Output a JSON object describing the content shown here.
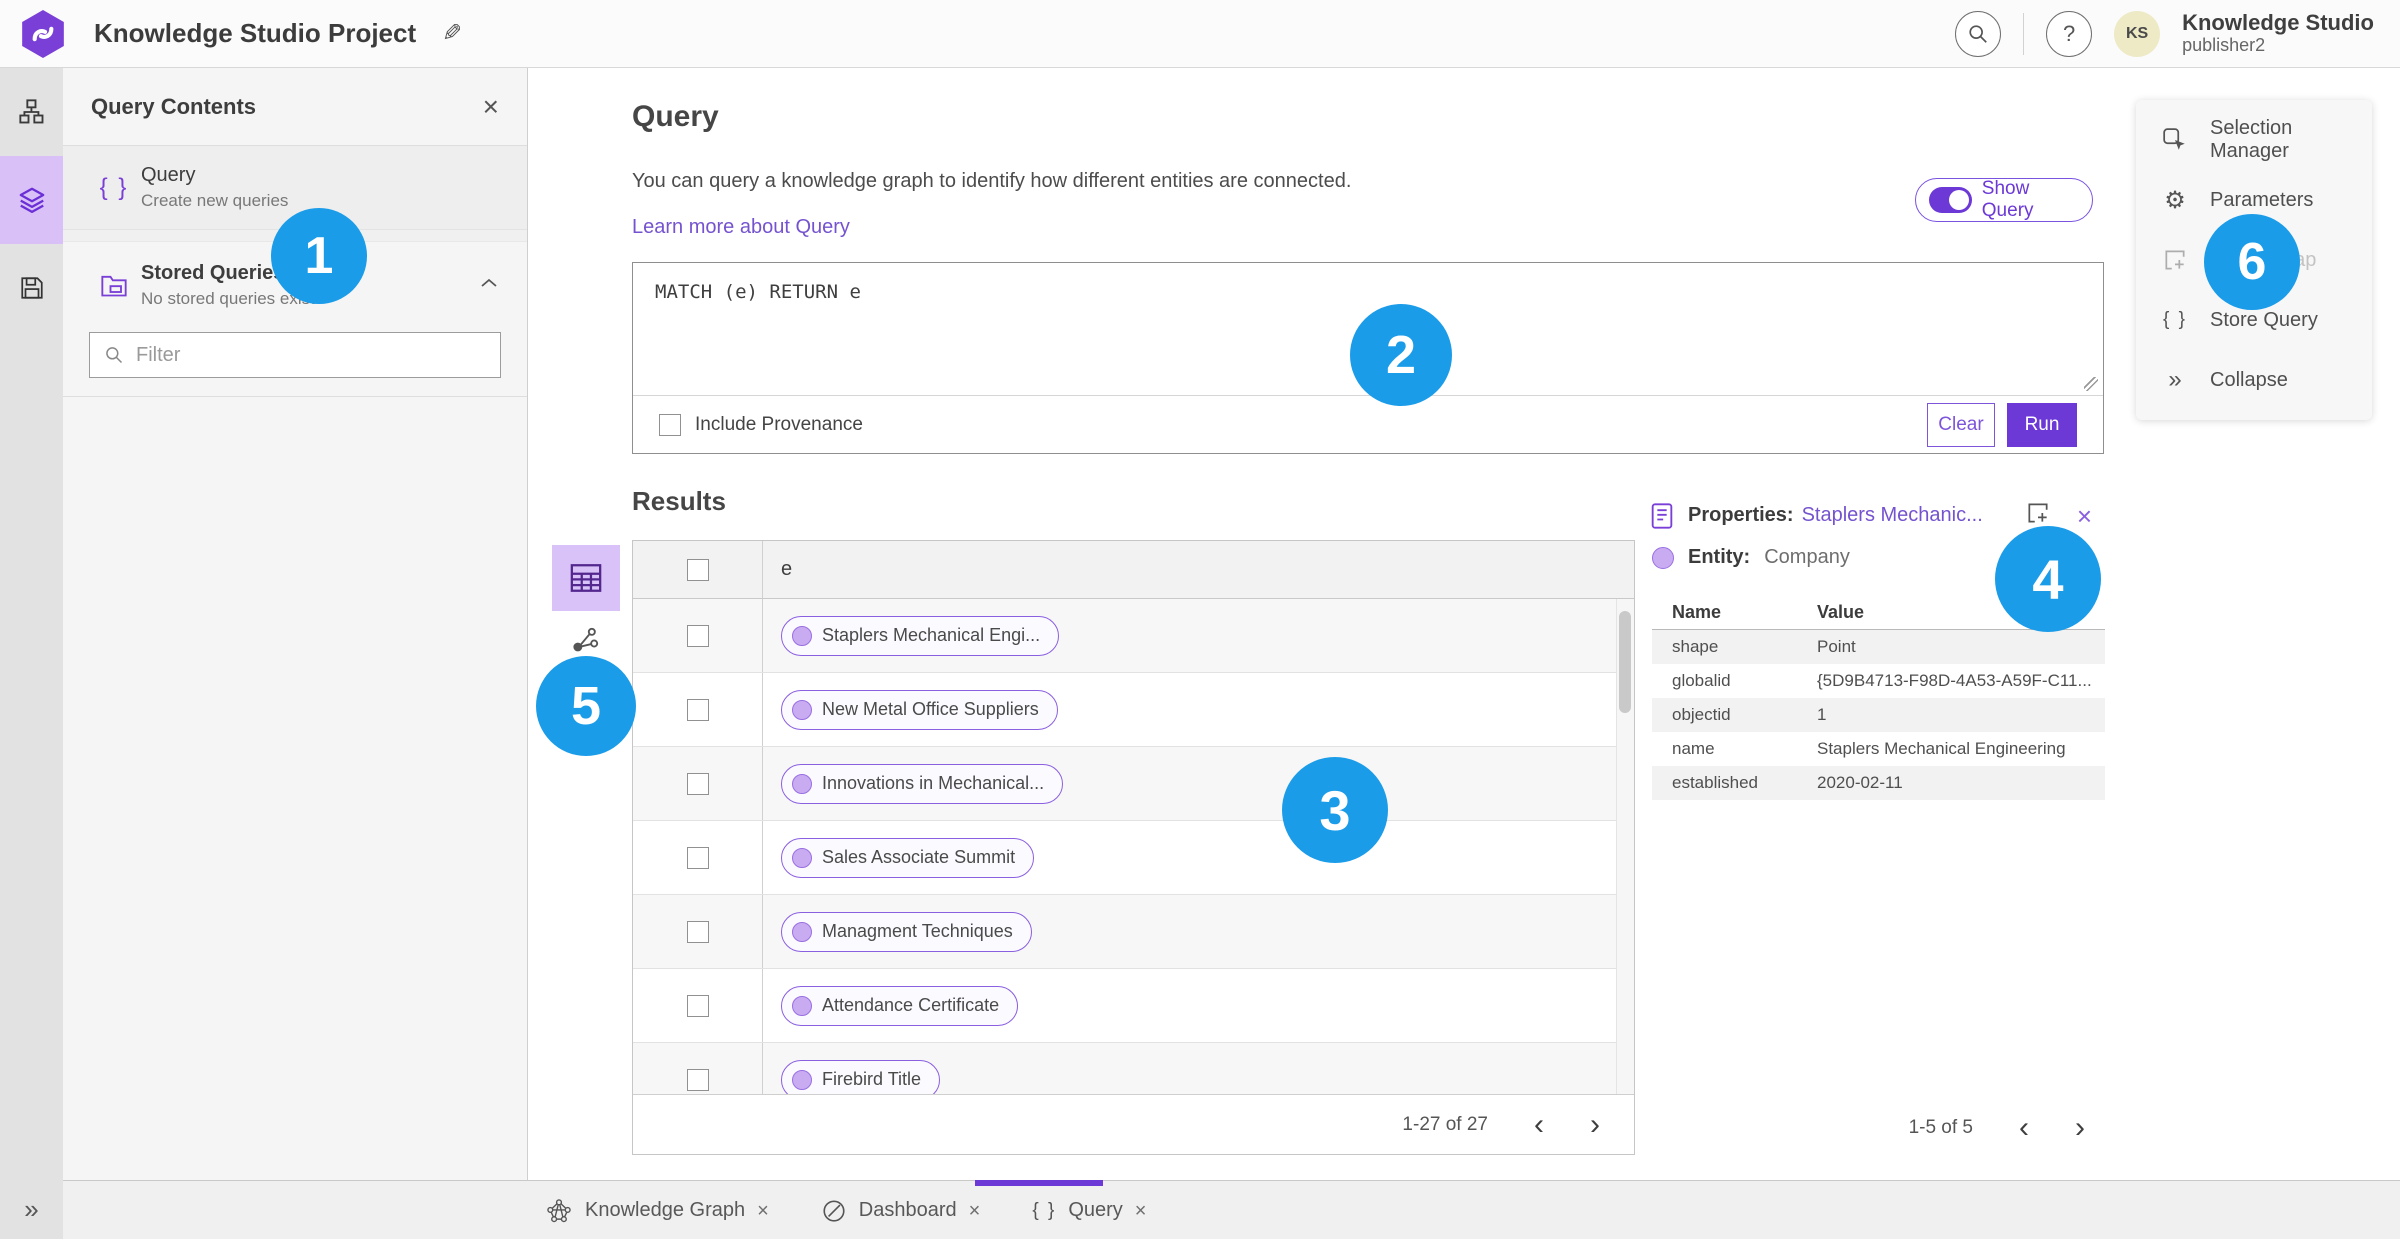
{
  "colors": {
    "accent_purple": "#6c38d6",
    "link_purple": "#7553cf",
    "callout_blue": "#1b9ce9",
    "rail_selected": "#d9c1f8"
  },
  "icons": {
    "edit": "✎",
    "help": "?",
    "close": "×",
    "chevron_left": "‹",
    "chevron_right": "›",
    "gear": "⚙",
    "collapse_double": "»",
    "expand_double": "»",
    "braces": "{ }"
  },
  "topbar": {
    "title": "Knowledge Studio Project",
    "user_name": "Knowledge Studio",
    "user_role": "publisher2",
    "avatar_initials": "KS"
  },
  "contents_panel": {
    "title": "Query Contents",
    "query_item": {
      "title": "Query",
      "subtitle": "Create new queries"
    },
    "stored_item": {
      "title": "Stored Queries",
      "subtitle": "No stored queries exist"
    },
    "filter_placeholder": "Filter"
  },
  "query_section": {
    "heading": "Query",
    "description": "You can query a knowledge graph to identify how different entities are connected.",
    "learn_link": "Learn more about Query",
    "show_query_label": "Show Query",
    "code": "MATCH (e) RETURN e",
    "provenance_label": "Include Provenance",
    "clear_label": "Clear",
    "run_label": "Run"
  },
  "results": {
    "heading": "Results",
    "column_header": "e",
    "rows": [
      "Staplers Mechanical Engi...",
      "New Metal Office Suppliers",
      "Innovations in Mechanical...",
      "Sales Associate Summit",
      "Managment Techniques",
      "Attendance Certificate",
      "Firebird Title"
    ],
    "pagination": "1-27 of 27"
  },
  "properties": {
    "label": "Properties:",
    "entity_link": "Staplers Mechanic...",
    "entity_label": "Entity:",
    "entity_type": "Company",
    "col_name": "Name",
    "col_value": "Value",
    "rows": [
      {
        "name": "shape",
        "value": "Point"
      },
      {
        "name": "globalid",
        "value": "{5D9B4713-F98D-4A53-A59F-C11..."
      },
      {
        "name": "objectid",
        "value": "1"
      },
      {
        "name": "name",
        "value": "Staplers Mechanical Engineering"
      },
      {
        "name": "established",
        "value": "2020-02-11"
      }
    ],
    "pagination": "1-5 of 5"
  },
  "right_menu": {
    "items": [
      {
        "label": "Selection Manager"
      },
      {
        "label": "Parameters"
      },
      {
        "label": "Add To Map",
        "disabled": true
      },
      {
        "label": "Store Query"
      },
      {
        "label": "Collapse"
      }
    ]
  },
  "tabs": [
    {
      "label": "Knowledge Graph"
    },
    {
      "label": "Dashboard"
    },
    {
      "label": "Query"
    }
  ],
  "callouts": [
    "1",
    "2",
    "3",
    "4",
    "5",
    "6"
  ]
}
